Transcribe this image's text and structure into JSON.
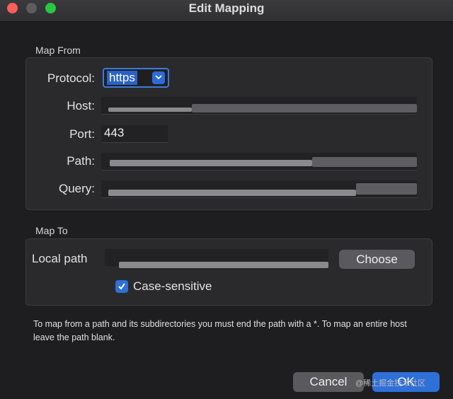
{
  "window": {
    "title": "Edit Mapping"
  },
  "map_from": {
    "section_label": "Map From",
    "protocol": {
      "label": "Protocol:",
      "value": "https"
    },
    "host": {
      "label": "Host:"
    },
    "port": {
      "label": "Port:",
      "value": "443"
    },
    "path": {
      "label": "Path:"
    },
    "query": {
      "label": "Query:"
    }
  },
  "map_to": {
    "section_label": "Map To",
    "local_path": {
      "label": "Local path"
    },
    "choose_label": "Choose",
    "case_sensitive": {
      "label": "Case-sensitive",
      "checked": true
    }
  },
  "note": "To map from a path and its subdirectories you must end the path with a *. To map an entire host leave the path blank.",
  "buttons": {
    "cancel": "Cancel",
    "ok": "OK"
  },
  "watermark": "@稀土掘金技术社区",
  "colors": {
    "accent": "#2f6fd8",
    "background": "#1e1e21",
    "group": "#2a2a2d"
  },
  "icons": {
    "close": "close-dot",
    "minimize": "minimize-dot",
    "maximize": "maximize-dot",
    "dropdown": "chevron-down-icon",
    "check": "checkmark-icon"
  }
}
